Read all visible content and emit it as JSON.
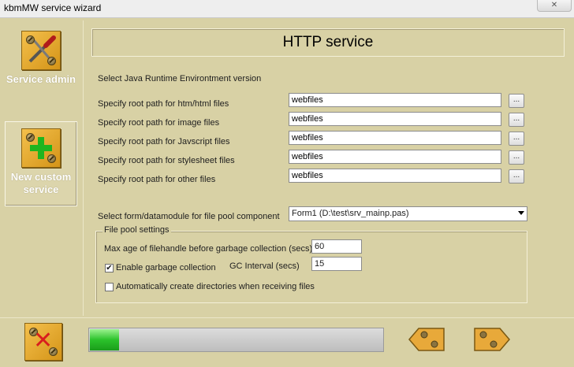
{
  "window": {
    "title": "kbmMW service wizard",
    "close_label": "✕"
  },
  "sidebar": {
    "items": [
      {
        "label": "Service admin",
        "icon": "tools-icon",
        "active": false
      },
      {
        "label": "New custom service",
        "icon": "add-plus-icon",
        "active": true
      }
    ]
  },
  "main": {
    "heading": "HTTP service",
    "jre_label": "Select Java Runtime Environtment version",
    "paths": [
      {
        "label": "Specify root path for htm/html files",
        "value": "webfiles"
      },
      {
        "label": "Specify root path for image files",
        "value": "webfiles"
      },
      {
        "label": "Specify root path for Javscript files",
        "value": "webfiles"
      },
      {
        "label": "Specify root path for stylesheet files",
        "value": "webfiles"
      },
      {
        "label": "Specify root path for other files",
        "value": "webfiles"
      }
    ],
    "browse_label": "...",
    "datamodule_label": "Select form/datamodule for file pool component",
    "datamodule_value": "Form1 (D:\\test\\srv_mainp.pas)",
    "file_pool": {
      "legend": "File pool settings",
      "max_age_label": "Max age of filehandle before garbage collection (secs)",
      "max_age_value": "60",
      "enable_gc_label": "Enable garbage collection",
      "enable_gc_checked": true,
      "gc_interval_label": "GC Interval (secs)",
      "gc_interval_value": "15",
      "auto_create_label": "Automatically create directories when receiving files",
      "auto_create_checked": false
    }
  },
  "footer": {
    "progress_fraction": 0.1,
    "progress_color": "#2bc22b",
    "back_icon": "back-arrow-icon",
    "next_icon": "next-arrow-icon",
    "cancel_icon": "cancel-x-icon"
  },
  "colors": {
    "background": "#d8d1a5",
    "icon_orange": "#e8a93a"
  }
}
